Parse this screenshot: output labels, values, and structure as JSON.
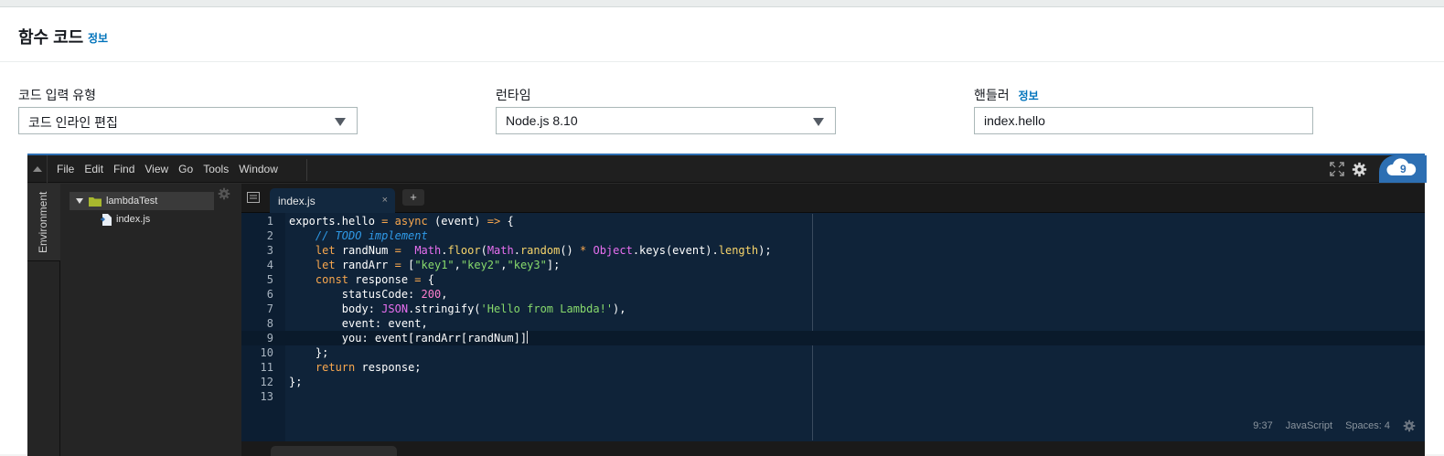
{
  "panel": {
    "title": "함수 코드",
    "info_link": "정보"
  },
  "fields": {
    "code_entry_type": {
      "label": "코드 입력 유형",
      "value": "코드 인라인 편집"
    },
    "runtime": {
      "label": "런타임",
      "value": "Node.js 8.10"
    },
    "handler": {
      "label": "핸들러",
      "info_link": "정보",
      "value": "index.hello"
    }
  },
  "ide": {
    "menu": [
      "File",
      "Edit",
      "Find",
      "View",
      "Go",
      "Tools",
      "Window"
    ],
    "environment_label": "Environment",
    "tree": {
      "folder": "lambdaTest",
      "file": "index.js"
    },
    "tab": {
      "label": "index.js",
      "close": "×"
    },
    "tab_add": "+",
    "code_lines": [
      "exports.hello = async (event) => {",
      "    // TODO implement",
      "    let randNum =  Math.floor(Math.random() * Object.keys(event).length);",
      "    let randArr = [\"key1\",\"key2\",\"key3\"];",
      "    const response = {",
      "        statusCode: 200,",
      "        body: JSON.stringify('Hello from Lambda!'),",
      "        event: event,",
      "        you: event[randArr[randNum]]",
      "    };",
      "    return response;",
      "};",
      ""
    ],
    "line_numbers": [
      "1",
      "2",
      "3",
      "4",
      "5",
      "6",
      "7",
      "8",
      "9",
      "10",
      "11",
      "12",
      "13"
    ],
    "active_line": 9,
    "status": {
      "cursor": "9:37",
      "language": "JavaScript",
      "indent": "Spaces: 4"
    },
    "colors": {
      "accent": "#2d6fb3",
      "editor_bg": "#0f2339",
      "keyword": "#f8a74e",
      "string": "#87d96c",
      "number": "#ff7fcf",
      "comment": "#2f9ae8"
    }
  }
}
